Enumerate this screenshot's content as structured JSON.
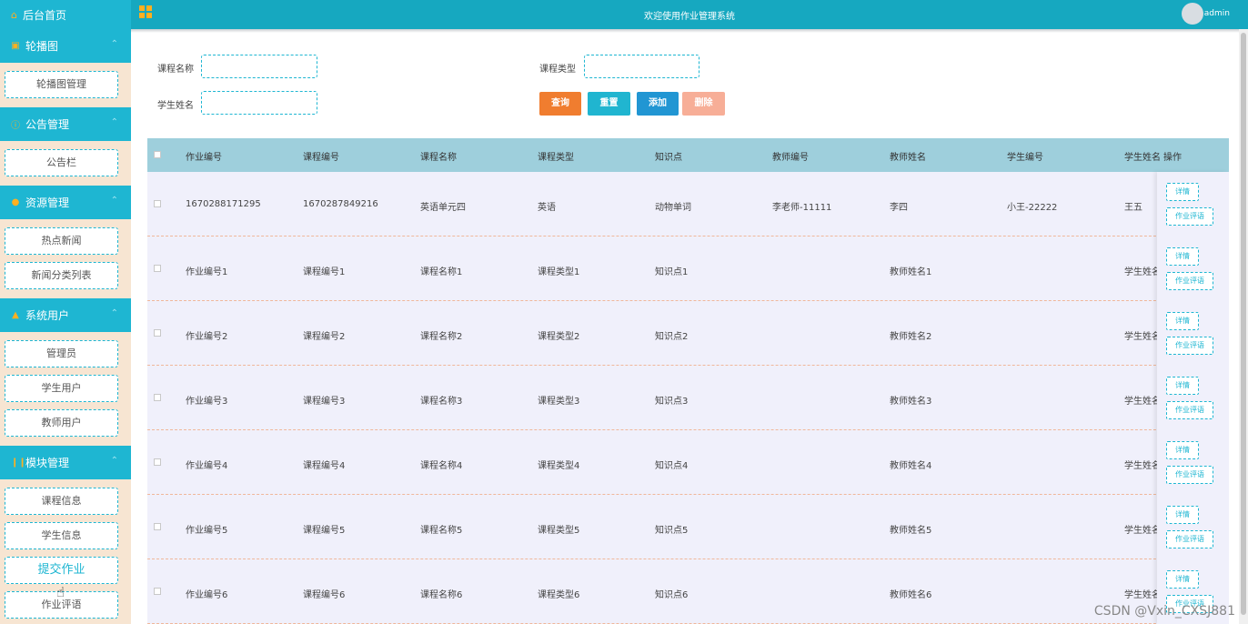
{
  "sidebar": {
    "home": "后台首页",
    "sections": [
      {
        "title": "轮播图",
        "items": [
          "轮播图管理"
        ]
      },
      {
        "title": "公告管理",
        "items": [
          "公告栏"
        ]
      },
      {
        "title": "资源管理",
        "items": [
          "热点新闻",
          "新闻分类列表"
        ]
      },
      {
        "title": "系统用户",
        "items": [
          "管理员",
          "学生用户",
          "教师用户"
        ]
      },
      {
        "title": "模块管理",
        "items": [
          "课程信息",
          "学生信息",
          "提交作业",
          "作业评语"
        ]
      }
    ]
  },
  "header": {
    "title": "欢迎使用作业管理系统",
    "user": "admin"
  },
  "search": {
    "course_name_label": "课程名称",
    "course_type_label": "课程类型",
    "student_name_label": "学生姓名",
    "query_button": "查询",
    "reset_button": "重置",
    "add_button": "添加",
    "delete_button": "删除"
  },
  "colors": {
    "primary": "#1eb6d2",
    "query": "#f07d2f",
    "reset": "#20b5d0",
    "add": "#2196d3",
    "delete": "#f7ae97",
    "header_row": "#9ecfdc"
  },
  "table": {
    "headers": [
      "作业编号",
      "课程编号",
      "课程名称",
      "课程类型",
      "知识点",
      "教师编号",
      "教师姓名",
      "学生编号",
      "学生姓名",
      "操作"
    ],
    "rows": [
      [
        "1670288171295",
        "1670287849216",
        "英语单元四",
        "英语",
        "动物单词",
        "李老师-11111",
        "李四",
        "小王-22222",
        "王五"
      ],
      [
        "作业编号1",
        "课程编号1",
        "课程名称1",
        "课程类型1",
        "知识点1",
        "",
        "教师姓名1",
        "",
        "学生姓名"
      ],
      [
        "作业编号2",
        "课程编号2",
        "课程名称2",
        "课程类型2",
        "知识点2",
        "",
        "教师姓名2",
        "",
        "学生姓名"
      ],
      [
        "作业编号3",
        "课程编号3",
        "课程名称3",
        "课程类型3",
        "知识点3",
        "",
        "教师姓名3",
        "",
        "学生姓名"
      ],
      [
        "作业编号4",
        "课程编号4",
        "课程名称4",
        "课程类型4",
        "知识点4",
        "",
        "教师姓名4",
        "",
        "学生姓名"
      ],
      [
        "作业编号5",
        "课程编号5",
        "课程名称5",
        "课程类型5",
        "知识点5",
        "",
        "教师姓名5",
        "",
        "学生姓名"
      ],
      [
        "作业编号6",
        "课程编号6",
        "课程名称6",
        "课程类型6",
        "知识点6",
        "",
        "教师姓名6",
        "",
        "学生姓名"
      ]
    ],
    "detail_button": "详情",
    "review_button": "作业评语"
  },
  "watermark": "CSDN @Vxin_CXSJ881"
}
